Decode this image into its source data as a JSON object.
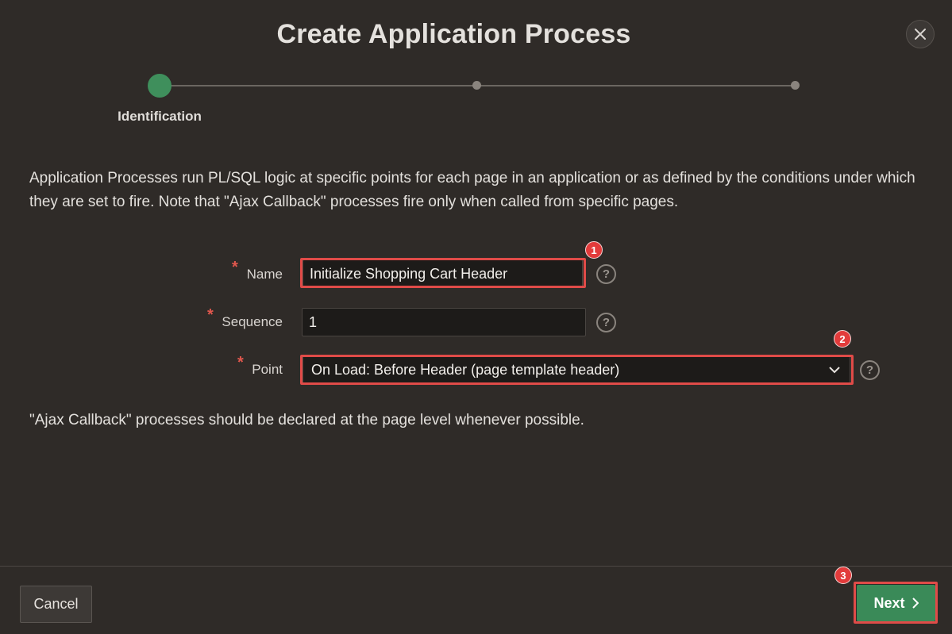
{
  "dialog": {
    "title": "Create Application Process"
  },
  "wizard": {
    "current_step_label": "Identification"
  },
  "intro_text": "Application Processes run PL/SQL logic at specific points for each page in an application or as defined by the conditions under which they are set to fire. Note that \"Ajax Callback\" processes fire only when called from specific pages.",
  "form": {
    "name": {
      "label": "Name",
      "required_mark": "*",
      "value": "Initialize Shopping Cart Header",
      "badge": "1"
    },
    "sequence": {
      "label": "Sequence",
      "required_mark": "*",
      "value": "1"
    },
    "point": {
      "label": "Point",
      "required_mark": "*",
      "value": "On Load: Before Header (page template header)",
      "badge": "2"
    },
    "help_glyph": "?"
  },
  "note_text": "\"Ajax Callback\" processes should be declared at the page level whenever possible.",
  "footer": {
    "cancel_label": "Cancel",
    "next_label": "Next",
    "next_badge": "3"
  },
  "colors": {
    "background": "#2f2b28",
    "accent_green": "#3a8a58",
    "highlight_red": "#e04b48",
    "required_red": "#e0574d"
  }
}
